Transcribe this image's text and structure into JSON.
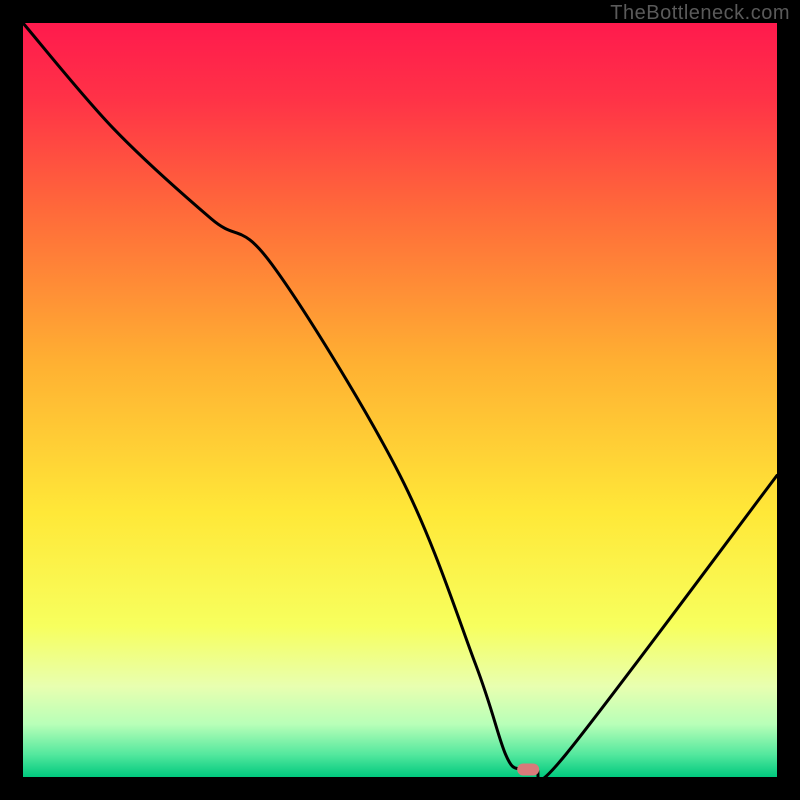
{
  "watermark": "TheBottleneck.com",
  "chart_data": {
    "type": "line",
    "title": "",
    "xlabel": "",
    "ylabel": "",
    "x_range": [
      0,
      100
    ],
    "y_range": [
      0,
      100
    ],
    "curve": {
      "name": "bottleneck-curve",
      "x": [
        0,
        12,
        25,
        33,
        50,
        60,
        64,
        66,
        68,
        72,
        100
      ],
      "y": [
        100,
        86,
        74,
        68,
        40,
        15,
        3,
        1,
        1,
        3,
        40
      ]
    },
    "marker": {
      "name": "optimal-point",
      "x": 67,
      "y": 1,
      "color": "#d97a7a"
    },
    "background_gradient": {
      "type": "vertical",
      "stops": [
        {
          "pos": 0.0,
          "color": "#ff1a4d"
        },
        {
          "pos": 0.1,
          "color": "#ff3247"
        },
        {
          "pos": 0.25,
          "color": "#ff6a3a"
        },
        {
          "pos": 0.45,
          "color": "#ffb032"
        },
        {
          "pos": 0.65,
          "color": "#ffe838"
        },
        {
          "pos": 0.8,
          "color": "#f7ff5e"
        },
        {
          "pos": 0.88,
          "color": "#e8ffb0"
        },
        {
          "pos": 0.93,
          "color": "#b8ffb8"
        },
        {
          "pos": 0.97,
          "color": "#54e89e"
        },
        {
          "pos": 1.0,
          "color": "#00c97e"
        }
      ]
    }
  }
}
